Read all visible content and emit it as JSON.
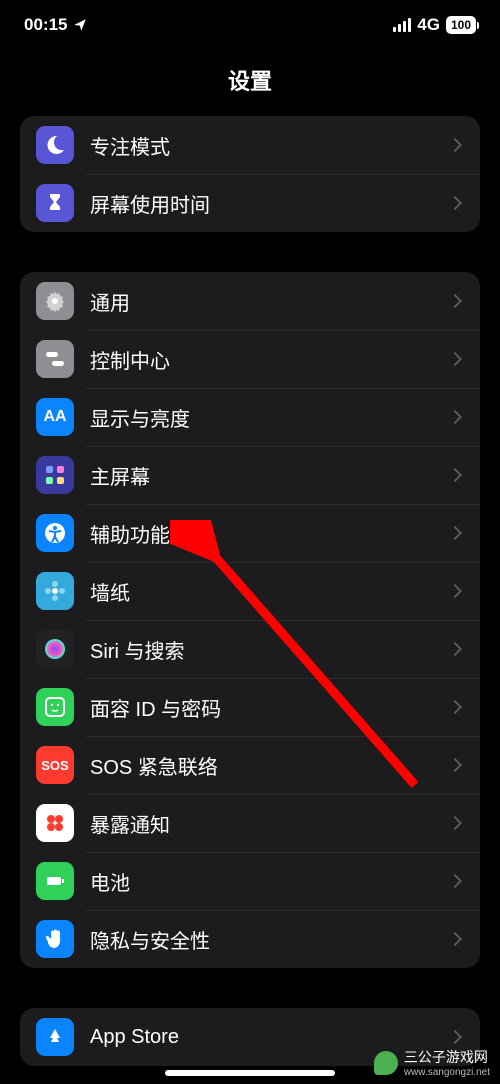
{
  "status": {
    "time": "00:15",
    "network": "4G",
    "battery": "100"
  },
  "header": {
    "title": "设置"
  },
  "groups": [
    {
      "rows": [
        {
          "name": "focus",
          "label": "专注模式",
          "icon": "moon-icon",
          "bg": "#5856d6"
        },
        {
          "name": "screentime",
          "label": "屏幕使用时间",
          "icon": "hourglass-icon",
          "bg": "#5856d6"
        }
      ]
    },
    {
      "rows": [
        {
          "name": "general",
          "label": "通用",
          "icon": "gear-icon",
          "bg": "#8e8e93"
        },
        {
          "name": "control-center",
          "label": "控制中心",
          "icon": "toggles-icon",
          "bg": "#8e8e93"
        },
        {
          "name": "display",
          "label": "显示与亮度",
          "icon": "aa-icon",
          "bg": "#0a84ff"
        },
        {
          "name": "home-screen",
          "label": "主屏幕",
          "icon": "grid-icon",
          "bg": "#3a3a9e"
        },
        {
          "name": "accessibility",
          "label": "辅助功能",
          "icon": "accessibility-icon",
          "bg": "#0a84ff"
        },
        {
          "name": "wallpaper",
          "label": "墙纸",
          "icon": "flower-icon",
          "bg": "#34aadc"
        },
        {
          "name": "siri",
          "label": "Siri 与搜索",
          "icon": "siri-icon",
          "bg": "#222"
        },
        {
          "name": "faceid",
          "label": "面容 ID 与密码",
          "icon": "faceid-icon",
          "bg": "#30d158"
        },
        {
          "name": "sos",
          "label": "SOS 紧急联络",
          "icon": "sos-icon",
          "bg": "#ff3b30"
        },
        {
          "name": "exposure",
          "label": "暴露通知",
          "icon": "exposure-icon",
          "bg": "#fff"
        },
        {
          "name": "battery",
          "label": "电池",
          "icon": "battery-icon",
          "bg": "#30d158"
        },
        {
          "name": "privacy",
          "label": "隐私与安全性",
          "icon": "hand-icon",
          "bg": "#0a84ff"
        }
      ]
    },
    {
      "rows": [
        {
          "name": "appstore",
          "label": "App Store",
          "icon": "appstore-icon",
          "bg": "#0a84ff"
        }
      ]
    }
  ],
  "annotation": {
    "arrow_color": "#ff0000",
    "target_row": "accessibility"
  },
  "watermark": {
    "text": "三公子游戏网",
    "url": "www.sangongzi.net"
  }
}
